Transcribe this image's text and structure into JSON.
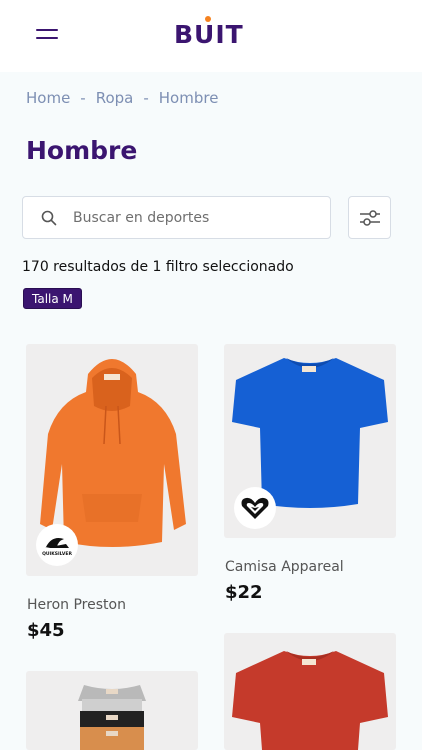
{
  "header": {
    "logo_text": "BUIT",
    "menu_icon": "hamburger-icon"
  },
  "breadcrumb": {
    "items": [
      "Home",
      "Ropa",
      "Hombre"
    ],
    "separator": "-"
  },
  "page": {
    "title": "Hombre"
  },
  "search": {
    "placeholder": "Buscar en deportes",
    "value": ""
  },
  "filters": {
    "results_text": "170 resultados de 1 filtro seleccionado",
    "active_chip": "Talla M"
  },
  "products": [
    {
      "name": "Heron Preston",
      "price": "$45",
      "brand_badge": "QUIKSILVER",
      "color": "#f0782e"
    },
    {
      "name": "Camisa Appareal",
      "price": "$22",
      "brand_badge": "ROXY",
      "color": "#1560d4"
    },
    {
      "name": "",
      "price": "",
      "color": "#333333"
    },
    {
      "name": "",
      "price": "",
      "color": "#c53a2b"
    }
  ],
  "colors": {
    "brand": "#3b1570",
    "accent": "#f58220",
    "muted": "#7d8fb3"
  }
}
